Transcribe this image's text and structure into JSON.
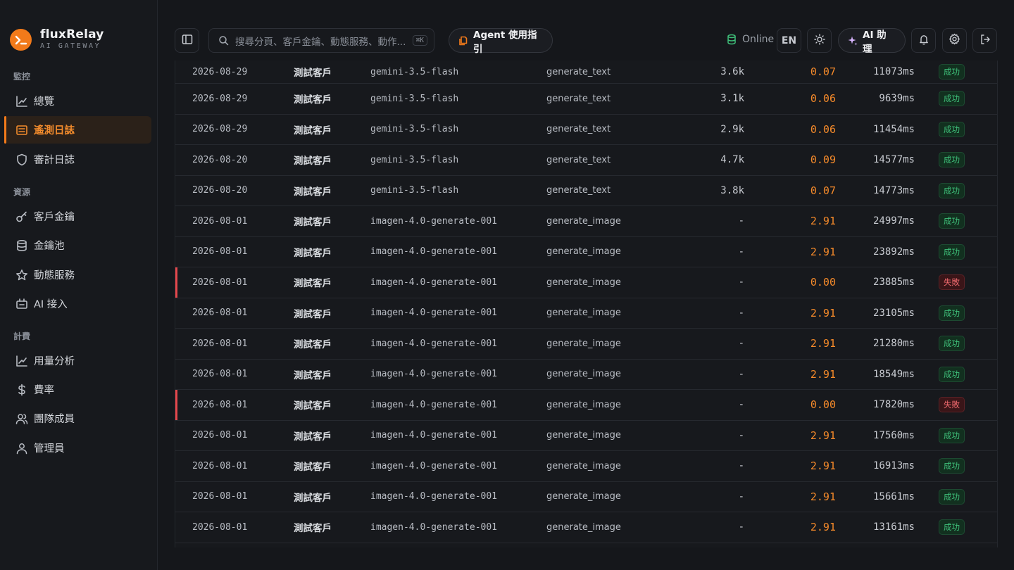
{
  "brand": {
    "name": "fluxRelay",
    "subtitle": "AI GATEWAY"
  },
  "nav": {
    "sections": [
      {
        "label": "監控",
        "items": [
          {
            "label": "總覽",
            "icon": "chart-line-icon"
          },
          {
            "label": "遙測日誌",
            "icon": "list-icon",
            "active": true
          },
          {
            "label": "審計日誌",
            "icon": "shield-icon"
          }
        ]
      },
      {
        "label": "資源",
        "items": [
          {
            "label": "客戶金鑰",
            "icon": "key-icon"
          },
          {
            "label": "金鑰池",
            "icon": "database-icon"
          },
          {
            "label": "動態服務",
            "icon": "star-icon"
          },
          {
            "label": "AI 接入",
            "icon": "plug-icon"
          }
        ]
      },
      {
        "label": "計費",
        "items": [
          {
            "label": "用量分析",
            "icon": "chart-line-icon"
          },
          {
            "label": "費率",
            "icon": "dollar-icon"
          },
          {
            "label": "團隊成員",
            "icon": "users-icon"
          },
          {
            "label": "管理員",
            "icon": "user-icon"
          }
        ]
      }
    ]
  },
  "topbar": {
    "search_placeholder": "搜尋分頁、客戶金鑰、動態服務、動作...",
    "search_shortcut": "⌘K",
    "agent_guide": "Agent 使用指引",
    "status": "Online",
    "language": "EN",
    "ai_assistant": "AI 助理"
  },
  "rows": [
    {
      "date": "2026-08-29",
      "client": "測試客戶",
      "model": "gemini-3.5-flash",
      "action": "generate_text",
      "tokens": "3.6k",
      "cost": "0.07",
      "latency": "11073ms",
      "status": "成功",
      "ok": true
    },
    {
      "date": "2026-08-29",
      "client": "測試客戶",
      "model": "gemini-3.5-flash",
      "action": "generate_text",
      "tokens": "3.1k",
      "cost": "0.06",
      "latency": "9639ms",
      "status": "成功",
      "ok": true
    },
    {
      "date": "2026-08-29",
      "client": "測試客戶",
      "model": "gemini-3.5-flash",
      "action": "generate_text",
      "tokens": "2.9k",
      "cost": "0.06",
      "latency": "11454ms",
      "status": "成功",
      "ok": true
    },
    {
      "date": "2026-08-20",
      "client": "測試客戶",
      "model": "gemini-3.5-flash",
      "action": "generate_text",
      "tokens": "4.7k",
      "cost": "0.09",
      "latency": "14577ms",
      "status": "成功",
      "ok": true
    },
    {
      "date": "2026-08-20",
      "client": "測試客戶",
      "model": "gemini-3.5-flash",
      "action": "generate_text",
      "tokens": "3.8k",
      "cost": "0.07",
      "latency": "14773ms",
      "status": "成功",
      "ok": true
    },
    {
      "date": "2026-08-01",
      "client": "測試客戶",
      "model": "imagen-4.0-generate-001",
      "action": "generate_image",
      "tokens": "-",
      "cost": "2.91",
      "latency": "24997ms",
      "status": "成功",
      "ok": true
    },
    {
      "date": "2026-08-01",
      "client": "測試客戶",
      "model": "imagen-4.0-generate-001",
      "action": "generate_image",
      "tokens": "-",
      "cost": "2.91",
      "latency": "23892ms",
      "status": "成功",
      "ok": true
    },
    {
      "date": "2026-08-01",
      "client": "測試客戶",
      "model": "imagen-4.0-generate-001",
      "action": "generate_image",
      "tokens": "-",
      "cost": "0.00",
      "latency": "23885ms",
      "status": "失敗",
      "ok": false
    },
    {
      "date": "2026-08-01",
      "client": "測試客戶",
      "model": "imagen-4.0-generate-001",
      "action": "generate_image",
      "tokens": "-",
      "cost": "2.91",
      "latency": "23105ms",
      "status": "成功",
      "ok": true
    },
    {
      "date": "2026-08-01",
      "client": "測試客戶",
      "model": "imagen-4.0-generate-001",
      "action": "generate_image",
      "tokens": "-",
      "cost": "2.91",
      "latency": "21280ms",
      "status": "成功",
      "ok": true
    },
    {
      "date": "2026-08-01",
      "client": "測試客戶",
      "model": "imagen-4.0-generate-001",
      "action": "generate_image",
      "tokens": "-",
      "cost": "2.91",
      "latency": "18549ms",
      "status": "成功",
      "ok": true
    },
    {
      "date": "2026-08-01",
      "client": "測試客戶",
      "model": "imagen-4.0-generate-001",
      "action": "generate_image",
      "tokens": "-",
      "cost": "0.00",
      "latency": "17820ms",
      "status": "失敗",
      "ok": false
    },
    {
      "date": "2026-08-01",
      "client": "測試客戶",
      "model": "imagen-4.0-generate-001",
      "action": "generate_image",
      "tokens": "-",
      "cost": "2.91",
      "latency": "17560ms",
      "status": "成功",
      "ok": true
    },
    {
      "date": "2026-08-01",
      "client": "測試客戶",
      "model": "imagen-4.0-generate-001",
      "action": "generate_image",
      "tokens": "-",
      "cost": "2.91",
      "latency": "16913ms",
      "status": "成功",
      "ok": true
    },
    {
      "date": "2026-08-01",
      "client": "測試客戶",
      "model": "imagen-4.0-generate-001",
      "action": "generate_image",
      "tokens": "-",
      "cost": "2.91",
      "latency": "15661ms",
      "status": "成功",
      "ok": true
    },
    {
      "date": "2026-08-01",
      "client": "測試客戶",
      "model": "imagen-4.0-generate-001",
      "action": "generate_image",
      "tokens": "-",
      "cost": "2.91",
      "latency": "13161ms",
      "status": "成功",
      "ok": true
    }
  ],
  "colors": {
    "accent": "#f27a1a",
    "success": "#3fc07a",
    "fail": "#e5484d",
    "online": "#3fc07a"
  }
}
